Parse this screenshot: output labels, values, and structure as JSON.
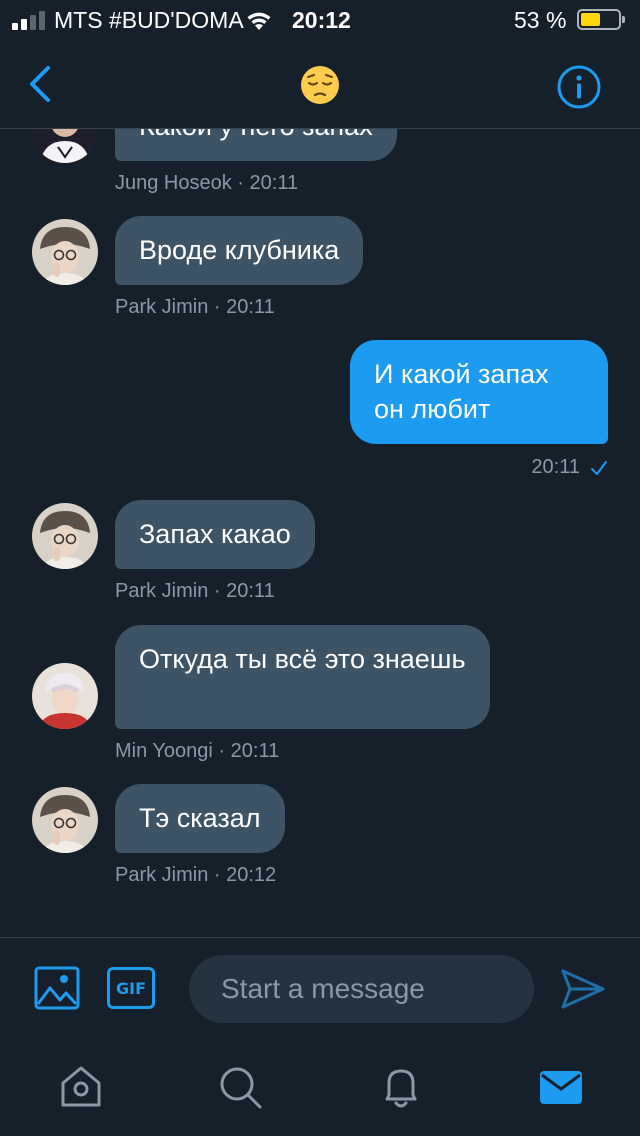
{
  "status_bar": {
    "carrier": "MTS #BUD'DOMA",
    "time": "20:12",
    "battery_percent": "53 %",
    "battery_level": 0.53
  },
  "header": {
    "title_emoji": "pensive-face-emoji",
    "back_icon": "chevron-left-icon",
    "info_icon": "info-icon"
  },
  "messages": [
    {
      "direction": "in",
      "text": "Какой у него запах",
      "meta": "Jung Hoseok · 20:11"
    },
    {
      "direction": "in",
      "text": "Вроде клубника",
      "meta": "Park Jimin · 20:11"
    },
    {
      "direction": "out",
      "text": "И какой запах он любит",
      "meta": "20:11",
      "read_icon": "checkmark-icon"
    },
    {
      "direction": "in",
      "text": "Запах какао",
      "meta": "Park Jimin · 20:11"
    },
    {
      "direction": "in",
      "text": "Откуда ты всё это знаешь",
      "meta": "Min Yoongi · 20:11"
    },
    {
      "direction": "in",
      "text": "Тэ сказал",
      "meta": "Park Jimin · 20:12"
    }
  ],
  "composer": {
    "gif_label": "GIF",
    "placeholder": "Start a message",
    "value": ""
  },
  "tab_bar": {
    "icons": [
      "home-icon",
      "search-icon",
      "notifications-icon",
      "messages-icon"
    ],
    "active": "messages-icon"
  },
  "colors": {
    "background": "#15202b",
    "accent": "#1d9bf0",
    "incoming_bubble": "#3d5466",
    "muted_text": "#8b98a5",
    "battery": "#ffd60a"
  }
}
